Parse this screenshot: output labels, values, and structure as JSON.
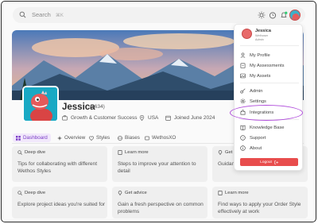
{
  "search": {
    "placeholder": "Search",
    "shortcut": "⌘K"
  },
  "topbar": {
    "icons": [
      "sun-icon",
      "clock-icon",
      "bell-icon"
    ],
    "notification_count": ""
  },
  "profile": {
    "name": "Jessica",
    "handle": "(2634)",
    "department": "Growth & Customer Success",
    "country": "USA",
    "joined": "Joined June 2024"
  },
  "tabs": [
    {
      "label": "Dashboard",
      "active": true
    },
    {
      "label": "Overview"
    },
    {
      "label": "Styles"
    },
    {
      "label": "Biases"
    },
    {
      "label": "WethosXO"
    }
  ],
  "cards": [
    {
      "tag": "Deep dive",
      "body": "Tips for collaborating with different Wethos Styles"
    },
    {
      "tag": "Learn more",
      "body": "Steps to improve your attention to detail"
    },
    {
      "tag": "Get a",
      "body": "Guidan effectively"
    },
    {
      "tag": "Deep dive",
      "body": "Explore project ideas you're suited for"
    },
    {
      "tag": "Get advice",
      "body": "Gain a fresh perspective on common problems"
    },
    {
      "tag": "Learn more",
      "body": "Find ways to apply your Order Style effectively at work"
    }
  ],
  "dropdown": {
    "name": "Jessica",
    "sub1": "Wethoser",
    "sub2": "Admin",
    "items": [
      {
        "label": "My Profile"
      },
      {
        "label": "My Assessments"
      },
      {
        "label": "My Assets"
      },
      {
        "label": "Admin"
      },
      {
        "label": "Settings"
      },
      {
        "label": "Integrations"
      },
      {
        "label": "Knowledge Base"
      },
      {
        "label": "Support"
      },
      {
        "label": "About"
      }
    ],
    "logout": "Logout"
  },
  "colors": {
    "accent": "#7a3cc7",
    "highlight": "#b04ddb",
    "logout": "#e84d4d",
    "notification": "#2ecc71"
  }
}
